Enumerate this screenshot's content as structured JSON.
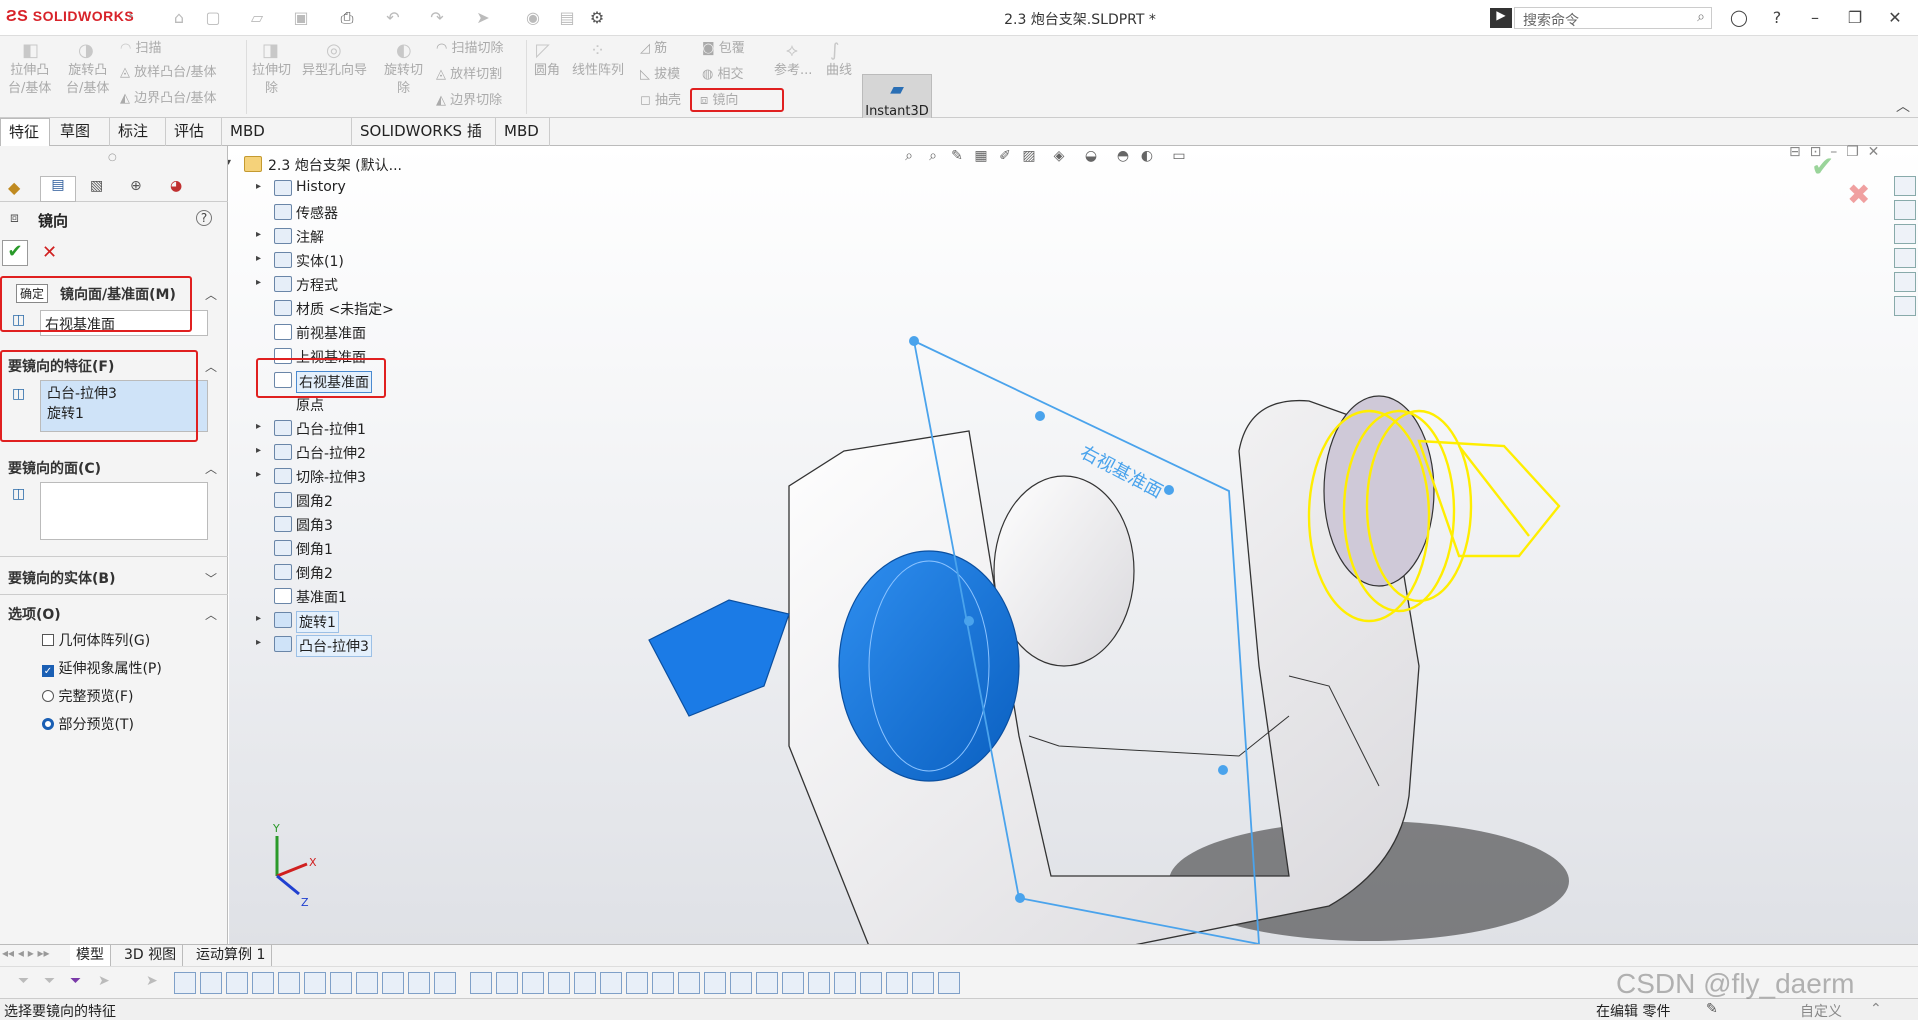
{
  "app": {
    "logo": "SOLIDWORKS",
    "doc_title": "2.3 炮台支架.SLDPRT *",
    "search_placeholder": "搜索命令"
  },
  "ribbon": {
    "col1": [
      "拉伸凸",
      "台/基体"
    ],
    "col2": [
      "旋转凸",
      "台/基体"
    ],
    "sweep": "扫描",
    "loft": "放样凸台/基体",
    "boundary": "边界凸台/基体",
    "cut_extrude": [
      "拉伸切",
      "除"
    ],
    "hole": "异型孔向导",
    "cut_revolve": [
      "旋转切",
      "除"
    ],
    "sweep_cut": "扫描切除",
    "loft_cut": "放样切割",
    "boundary_cut": "边界切除",
    "fillet": "圆角",
    "linear_pattern": "线性阵列",
    "rib": "筋",
    "draft": "拔模",
    "shell": "抽壳",
    "wrap": "包覆",
    "intersect": "相交",
    "mirror": "镜向",
    "ref": "参考...",
    "curves": "曲线",
    "instant3d": "Instant3D"
  },
  "tabs": [
    "特征",
    "草图",
    "标注",
    "评估",
    "MBD Dimensions",
    "SOLIDWORKS 插件",
    "MBD"
  ],
  "pm": {
    "title": "镜向",
    "ok_tooltip": "确定",
    "plane_header": "镜向面/基准面(M)",
    "plane_value": "右视基准面",
    "features_header": "要镜向的特征(F)",
    "features": [
      "凸台-拉伸3",
      "旋转1"
    ],
    "faces_header": "要镜向的面(C)",
    "bodies_header": "要镜向的实体(B)",
    "options_header": "选项(O)",
    "opt_geometry": "几何体阵列(G)",
    "opt_visual": "延伸视象属性(P)",
    "opt_full": "完整预览(F)",
    "opt_partial": "部分预览(T)"
  },
  "tree": {
    "root": "2.3 炮台支架 (默认...",
    "items": [
      "History",
      "传感器",
      "注解",
      "实体(1)",
      "方程式",
      "材质 <未指定>",
      "前视基准面",
      "上视基准面",
      "右视基准面",
      "原点",
      "凸台-拉伸1",
      "凸台-拉伸2",
      "切除-拉伸3",
      "圆角2",
      "圆角3",
      "倒角1",
      "倒角2",
      "基准面1",
      "旋转1",
      "凸台-拉伸3"
    ]
  },
  "viewport": {
    "plane_label": "右视基准面",
    "triad_x": "X",
    "triad_y": "Y",
    "triad_z": "Z"
  },
  "bottom_tabs": [
    "模型",
    "3D 视图",
    "运动算例 1"
  ],
  "status": {
    "left": "选择要镜向的特征",
    "editing": "在编辑 零件",
    "custom": "自定义",
    "watermark": "CSDN @fly_daerm"
  }
}
